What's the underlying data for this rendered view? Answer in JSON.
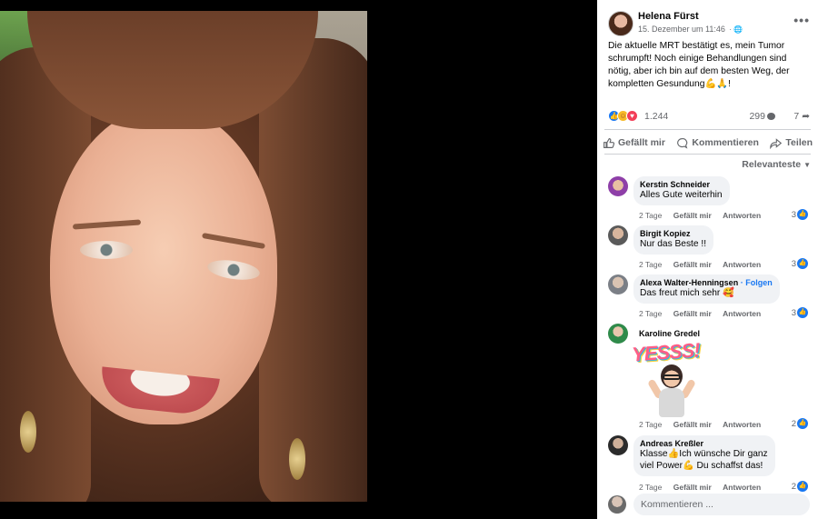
{
  "post": {
    "author": "Helena Fürst",
    "date": "15. Dezember um 11:46",
    "text": "Die aktuelle MRT bestätigt es, mein Tumor schrumpft! Noch einige Behandlungen sind nötig, aber ich bin auf dem besten Weg, der kompletten Gesundung💪🙏!",
    "reaction_count": "1.244",
    "comment_count": "299",
    "share_count": "7",
    "more_icon": "ellipsis-icon",
    "privacy_icon": "globe-icon"
  },
  "actions": {
    "like": "Gefällt mir",
    "comment": "Kommentieren",
    "share": "Teilen"
  },
  "sort_label": "Relevanteste",
  "comments": [
    {
      "name": "Kerstin Schneider",
      "text": "Alles Gute weiterhin",
      "time": "2 Tage",
      "like": "Gefällt mir",
      "reply": "Antworten",
      "likes": "3"
    },
    {
      "name": "Birgit Kopiez",
      "text": "Nur das Beste !!",
      "time": "2 Tage",
      "like": "Gefällt mir",
      "reply": "Antworten",
      "likes": "3"
    },
    {
      "name": "Alexa Walter-Henningsen",
      "follow": "· Folgen",
      "text": "Das freut mich sehr 🥰",
      "time": "2 Tage",
      "like": "Gefällt mir",
      "reply": "Antworten",
      "likes": "3"
    },
    {
      "name": "Karoline Gredel",
      "sticker_text": "YESSS!",
      "time": "2 Tage",
      "like": "Gefällt mir",
      "reply": "Antworten",
      "likes": "2"
    },
    {
      "name": "Andreas Kreßler",
      "text_line1": "Klasse👍Ich wünsche Dir ganz",
      "text_line2": "viel Power💪 Du schaffst das!",
      "time": "2 Tage",
      "like": "Gefällt mir",
      "reply": "Antworten",
      "likes": "2"
    }
  ],
  "write_comment_placeholder": "Kommentieren ...",
  "colors": {
    "accent": "#1877f2",
    "muted": "#65676b",
    "bubble": "#f0f2f5"
  }
}
